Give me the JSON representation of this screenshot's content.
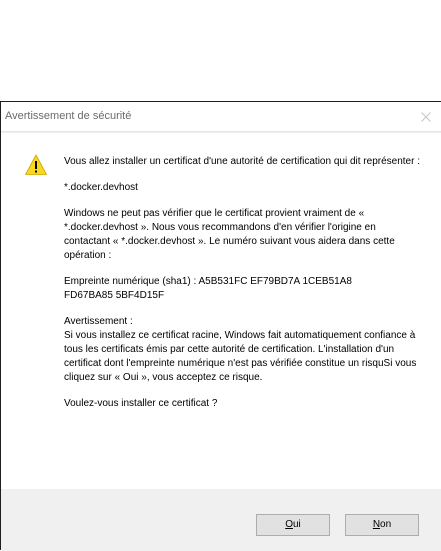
{
  "window": {
    "title": "Avertissement de sécurité"
  },
  "message": {
    "intro": "Vous allez installer un certificat d'une autorité de certification qui dit représenter :",
    "host": "*.docker.devhost",
    "verify": "Windows ne peut pas vérifier que le certificat provient vraiment de « *.docker.devhost ». Nous vous recommandons d'en vérifier l'origine en contactant « *.docker.devhost ». Le numéro suivant vous aidera dans cette opération :",
    "thumbprint_line1": "Empreinte numérique (sha1) : A5B531FC EF79BD7A 1CEB51A8",
    "thumbprint_line2": "FD67BA85 5BF4D15F",
    "warning_heading": "Avertissement :",
    "warning_body": "Si vous installez ce certificat racine, Windows fait automatiquement confiance à tous les certificats émis par cette autorité de certification. L'installation d'un certificat dont l'empreinte numérique n'est pas vérifiée constitue un risquSi vous cliquez sur « Oui », vous acceptez ce risque.",
    "question": "Voulez-vous installer ce certificat ?"
  },
  "buttons": {
    "yes_accel": "O",
    "yes_rest": "ui",
    "no_accel": "N",
    "no_rest": "on"
  },
  "icons": {
    "warning": "warning-icon",
    "close": "close-icon"
  },
  "colors": {
    "warning_yellow": "#f8d71c",
    "footer_bg": "#f0f0f0",
    "button_bg": "#e1e1e1"
  }
}
